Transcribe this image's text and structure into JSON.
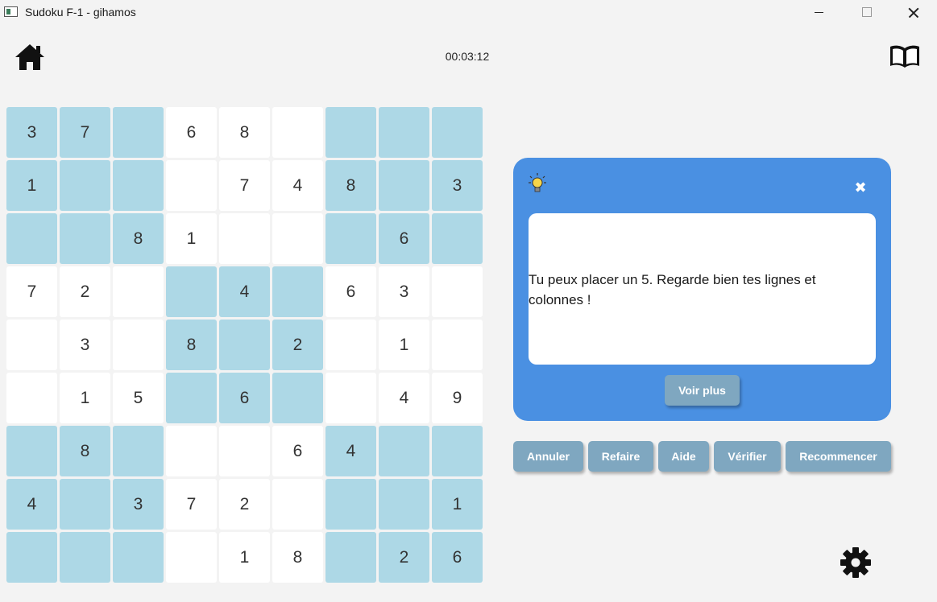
{
  "window": {
    "title": "Sudoku F-1 - gihamos"
  },
  "header": {
    "timer": "00:03:12"
  },
  "grid": [
    [
      "3",
      "7",
      "",
      "6",
      "8",
      "",
      "",
      "",
      ""
    ],
    [
      "1",
      "",
      "",
      "",
      "7",
      "4",
      "8",
      "",
      "3"
    ],
    [
      "",
      "",
      "8",
      "1",
      "",
      "",
      "",
      "6",
      ""
    ],
    [
      "7",
      "2",
      "",
      "",
      "4",
      "",
      "6",
      "3",
      ""
    ],
    [
      "",
      "3",
      "",
      "8",
      "",
      "2",
      "",
      "1",
      ""
    ],
    [
      "",
      "1",
      "5",
      "",
      "6",
      "",
      "",
      "4",
      "9"
    ],
    [
      "",
      "8",
      "",
      "",
      "",
      "6",
      "4",
      "",
      ""
    ],
    [
      "4",
      "",
      "3",
      "7",
      "2",
      "",
      "",
      "",
      "1"
    ],
    [
      "",
      "",
      "",
      "",
      "1",
      "8",
      "",
      "2",
      "6"
    ]
  ],
  "grid_colors": {
    "given_box": "#add8e6",
    "empty_box": "#ffffff"
  },
  "hint": {
    "text": "Tu peux placer un 5. Regarde bien tes lignes et colonnes !",
    "more_label": "Voir plus",
    "close_symbol": "✖"
  },
  "actions": {
    "undo": "Annuler",
    "redo": "Refaire",
    "help": "Aide",
    "check": "Vérifier",
    "restart": "Recommencer"
  },
  "colors": {
    "panel": "#4a90e2",
    "button": "#7fa7c0",
    "background": "#f3f3f3"
  },
  "icons": {
    "home": "home-icon",
    "book": "book-icon",
    "bulb": "lightbulb-icon",
    "settings": "gear-icon"
  }
}
